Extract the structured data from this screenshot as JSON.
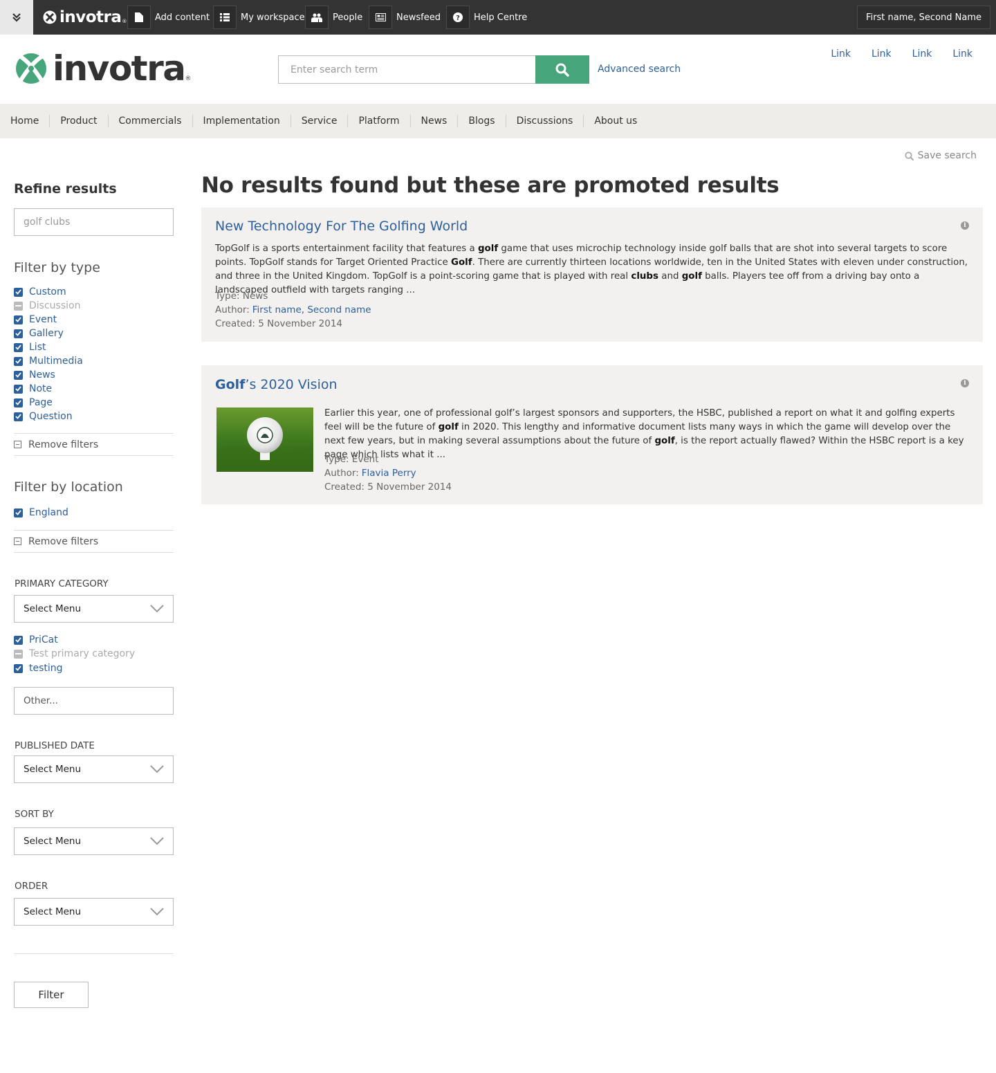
{
  "topbar": {
    "brand": "invotra",
    "buttons": [
      {
        "label": "Add content",
        "icon": "document-icon"
      },
      {
        "label": "My workspace",
        "icon": "list-icon"
      },
      {
        "label": "People",
        "icon": "people-icon"
      },
      {
        "label": "Newsfeed",
        "icon": "newspaper-icon"
      },
      {
        "label": "Help Centre",
        "icon": "question-icon"
      }
    ],
    "user": "First name, Second Name"
  },
  "header": {
    "brand": "invotra",
    "search_placeholder": "Enter search term",
    "advanced_search": "Advanced search",
    "links": [
      "Link",
      "Link",
      "Link",
      "Link"
    ]
  },
  "nav": [
    "Home",
    "Product",
    "Commercials",
    "Implementation",
    "Service",
    "Platform",
    "News",
    "Blogs",
    "Discussions",
    "About us"
  ],
  "sidebar": {
    "refine_title": "Refine results",
    "keyword": "golf clubs",
    "filter_type_title": "Filter by type",
    "types": [
      {
        "label": "Custom",
        "state": "checked"
      },
      {
        "label": "Discussion",
        "state": "disabled"
      },
      {
        "label": "Event",
        "state": "checked"
      },
      {
        "label": "Gallery",
        "state": "checked"
      },
      {
        "label": "List",
        "state": "checked"
      },
      {
        "label": "Multimedia",
        "state": "checked"
      },
      {
        "label": "News",
        "state": "checked"
      },
      {
        "label": "Note",
        "state": "checked"
      },
      {
        "label": "Page",
        "state": "checked"
      },
      {
        "label": "Question",
        "state": "checked"
      }
    ],
    "remove_filters": "Remove filters",
    "filter_location_title": "Filter by location",
    "locations": [
      {
        "label": "England",
        "state": "checked"
      }
    ],
    "primary_category_label": "PRIMARY CATEGORY",
    "select_menu": "Select Menu",
    "categories": [
      {
        "label": "PriCat",
        "state": "checked"
      },
      {
        "label": "Test primary category",
        "state": "disabled"
      },
      {
        "label": "testing",
        "state": "checked"
      }
    ],
    "other_placeholder": "Other...",
    "published_date_label": "PUBLISHED DATE",
    "sort_by_label": "SORT BY",
    "order_label": "ORDER",
    "filter_button": "Filter"
  },
  "main": {
    "save_search": "Save search",
    "heading": "No results found but these are promoted results",
    "results": [
      {
        "title": "New Technology For The Golfing World",
        "description_parts": [
          {
            "t": "TopGolf is a sports entertainment facility that features a "
          },
          {
            "t": "golf",
            "b": true
          },
          {
            "t": " game that uses microchip technology inside golf balls that are shot into several targets to score points. TopGolf stands for Target Oriented Practice "
          },
          {
            "t": "Golf",
            "b": true
          },
          {
            "t": ". There are currently thirteen locations worldwide, ten in the United States with eleven under construction, and three in the United Kingdom. TopGolf is a point-scoring game that is played with real "
          },
          {
            "t": "clubs",
            "b": true
          },
          {
            "t": " and "
          },
          {
            "t": "golf",
            "b": true
          },
          {
            "t": " balls. Players tee off from a driving bay onto a landscaped outfield with targets ranging ..."
          }
        ],
        "type": "Type: News",
        "author_label": "Author:",
        "author": "First name, Second name",
        "created": "Created: 5 November 2014"
      },
      {
        "title_bold": "Golf",
        "title_rest": "’s 2020 Vision",
        "description_parts": [
          {
            "t": "Earlier this year, one of professional golf’s largest sponsors and supporters, the HSBC, published a report on what it and golfing experts feel will be the future of "
          },
          {
            "t": "golf",
            "b": true
          },
          {
            "t": " in 2020. This lengthy and informative document lists many ways in which the game will develop over the next few years, but in making several assumptions about the future of "
          },
          {
            "t": "golf",
            "b": true
          },
          {
            "t": ", is the report actually flawed? Within the HSBC report is a key page which lists what it ..."
          }
        ],
        "type": "Type: Event",
        "author_label": "Author:",
        "author": "Flavia Perry",
        "created": "Created: 5 November 2014"
      }
    ]
  },
  "colors": {
    "accent_green": "#46a57a",
    "link_blue": "#2d5f9a",
    "topbar": "#333333",
    "nav_bg": "#eeedea",
    "card_bg": "#f2f1ef"
  }
}
